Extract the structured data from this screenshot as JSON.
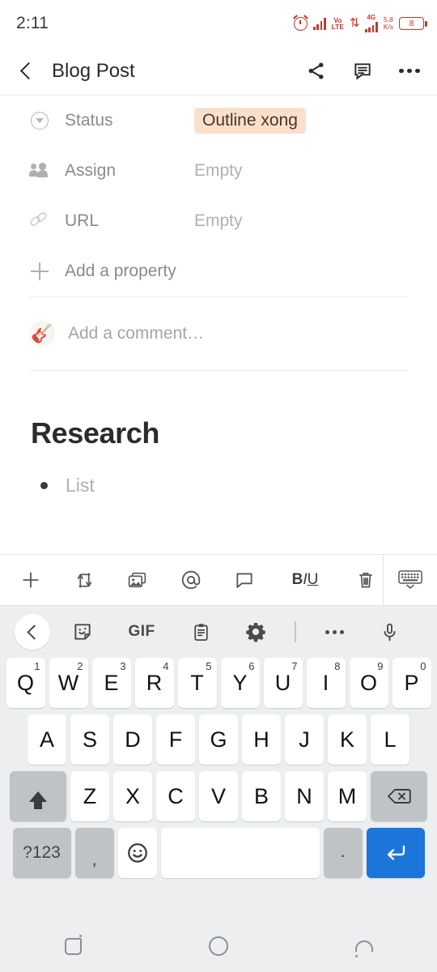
{
  "status_bar": {
    "time": "2:11",
    "alarm_icon": "alarm-clock-icon",
    "network_label": "VoLTE",
    "volte_top": "Vo",
    "volte_bottom": "LTE",
    "data_arrows_icon": "data-transfer-icon",
    "generation_label": "4G",
    "speed_value": "5,8",
    "speed_unit": "K/s",
    "battery_level": "8"
  },
  "app_bar": {
    "back_icon": "chevron-left-icon",
    "title": "Blog Post",
    "share_icon": "share-icon",
    "comment_icon": "comment-icon",
    "more_icon": "more-options-icon"
  },
  "properties": [
    {
      "icon": "select-icon",
      "label": "Status",
      "value": "Outline xong",
      "is_badge": true,
      "badge_bg": "#fae0cc",
      "badge_fg": "#4a3526"
    },
    {
      "icon": "people-icon",
      "label": "Assign",
      "value": "Empty",
      "is_badge": false
    },
    {
      "icon": "link-icon",
      "label": "URL",
      "value": "Empty",
      "is_badge": false
    }
  ],
  "add_property": {
    "icon": "plus-icon",
    "label": "Add a property"
  },
  "comment_box": {
    "avatar_emoji": "🎸",
    "placeholder": "Add a comment…"
  },
  "document": {
    "heading": "Research",
    "bullets": [
      {
        "text": "List"
      }
    ]
  },
  "editor_toolbar": {
    "items": [
      {
        "name": "add-block-button",
        "icon": "plus-icon",
        "label": "+"
      },
      {
        "name": "move-block-button",
        "icon": "transfer-arrows-icon",
        "label": ""
      },
      {
        "name": "insert-image-button",
        "icon": "image-icon",
        "label": ""
      },
      {
        "name": "mention-button",
        "icon": "at-mention-icon",
        "label": "@"
      },
      {
        "name": "comment-button",
        "icon": "comment-bubble-icon",
        "label": ""
      },
      {
        "name": "text-format-button",
        "icon": "bold-italic-underline-icon",
        "label": "BIU"
      },
      {
        "name": "delete-block-button",
        "icon": "trash-icon",
        "label": ""
      }
    ],
    "keyboard_toggle": {
      "name": "hide-keyboard-button",
      "icon": "keyboard-icon"
    }
  },
  "keyboard": {
    "toolbar": [
      {
        "name": "kb-collapse-button",
        "icon": "chevron-left-icon",
        "label": ""
      },
      {
        "name": "sticker-button",
        "icon": "sticker-icon",
        "label": ""
      },
      {
        "name": "gif-button",
        "icon": "gif-icon",
        "label": "GIF"
      },
      {
        "name": "clipboard-button",
        "icon": "clipboard-icon",
        "label": ""
      },
      {
        "name": "settings-button",
        "icon": "gear-icon",
        "label": ""
      },
      {
        "name": "kb-more-button",
        "icon": "more-options-icon",
        "label": ""
      },
      {
        "name": "voice-input-button",
        "icon": "microphone-icon",
        "label": ""
      }
    ],
    "row1": [
      {
        "key": "Q",
        "sup": "1"
      },
      {
        "key": "W",
        "sup": "2"
      },
      {
        "key": "E",
        "sup": "3"
      },
      {
        "key": "R",
        "sup": "4"
      },
      {
        "key": "T",
        "sup": "5"
      },
      {
        "key": "Y",
        "sup": "6"
      },
      {
        "key": "U",
        "sup": "7"
      },
      {
        "key": "I",
        "sup": "8"
      },
      {
        "key": "O",
        "sup": "9"
      },
      {
        "key": "P",
        "sup": "0"
      }
    ],
    "row2": [
      {
        "key": "A"
      },
      {
        "key": "S"
      },
      {
        "key": "D"
      },
      {
        "key": "F"
      },
      {
        "key": "G"
      },
      {
        "key": "H"
      },
      {
        "key": "J"
      },
      {
        "key": "K"
      },
      {
        "key": "L"
      }
    ],
    "row3_letters": [
      {
        "key": "Z"
      },
      {
        "key": "X"
      },
      {
        "key": "C"
      },
      {
        "key": "V"
      },
      {
        "key": "B"
      },
      {
        "key": "N"
      },
      {
        "key": "M"
      }
    ],
    "shift_key": {
      "name": "shift-key",
      "icon": "shift-arrow-icon"
    },
    "backspace_key": {
      "name": "backspace-key",
      "icon": "backspace-icon"
    },
    "row4": {
      "symbols_key": "?123",
      "comma_key": ",",
      "emoji_key": "☺",
      "space_key": "",
      "period_key": ".",
      "enter_key": "↵",
      "enter_bg": "#1c75d9"
    }
  },
  "nav_bar": {
    "recent_icon": "recent-apps-icon",
    "home_icon": "home-icon",
    "back_icon": "back-icon"
  }
}
